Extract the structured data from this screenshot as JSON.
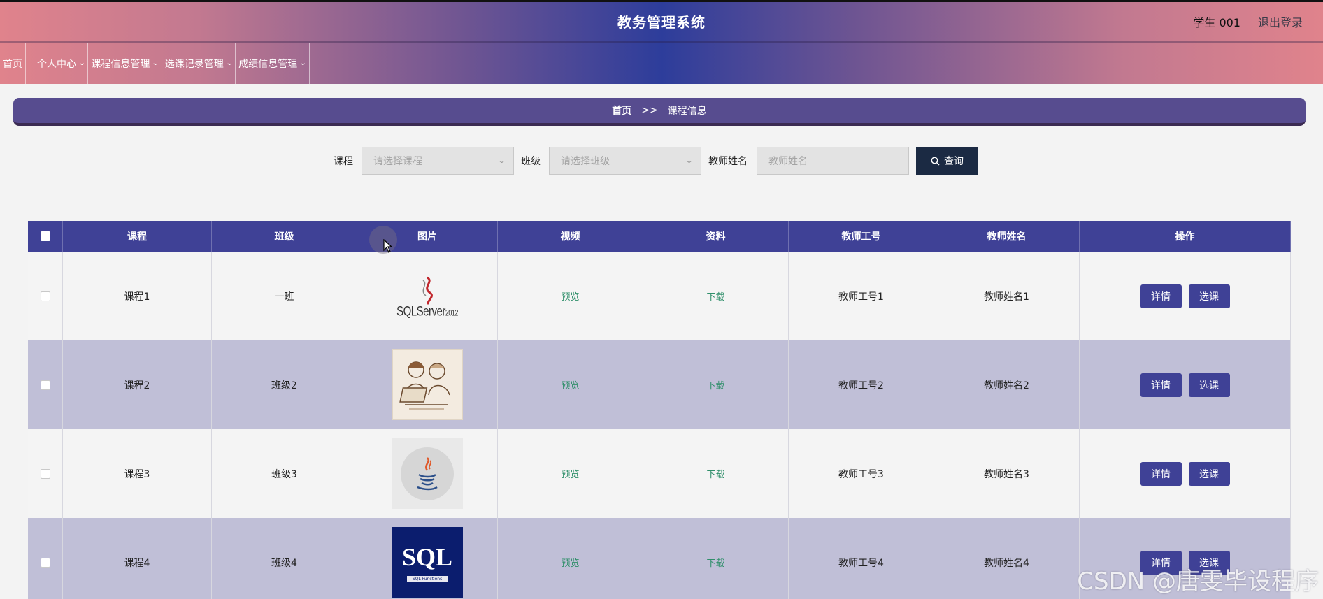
{
  "header": {
    "title": "教务管理系统",
    "user": "学生 001",
    "logout": "退出登录"
  },
  "nav": {
    "items": [
      {
        "label": "首页",
        "has_dropdown": false
      },
      {
        "label": "个人中心",
        "has_dropdown": true
      },
      {
        "label": "课程信息管理",
        "has_dropdown": true
      },
      {
        "label": "选课记录管理",
        "has_dropdown": true
      },
      {
        "label": "成绩信息管理",
        "has_dropdown": true
      }
    ]
  },
  "breadcrumb": {
    "home": "首页",
    "separator": ">>",
    "current": "课程信息"
  },
  "search": {
    "course_label": "课程",
    "course_placeholder": "请选择课程",
    "class_label": "班级",
    "class_placeholder": "请选择班级",
    "teacher_label": "教师姓名",
    "teacher_placeholder": "教师姓名",
    "query_button": "查询"
  },
  "table": {
    "headers": [
      "课程",
      "班级",
      "图片",
      "视频",
      "资料",
      "教师工号",
      "教师姓名",
      "操作"
    ],
    "rows": [
      {
        "course": "课程1",
        "class": "一班",
        "image": "sqlserver-logo",
        "video": "预览",
        "material": "下载",
        "teacher_id": "教师工号1",
        "teacher_name": "教师姓名1",
        "detail": "详情",
        "select": "选课"
      },
      {
        "course": "课程2",
        "class": "班级2",
        "image": "people-computer-sketch",
        "video": "预览",
        "material": "下载",
        "teacher_id": "教师工号2",
        "teacher_name": "教师姓名2",
        "detail": "详情",
        "select": "选课"
      },
      {
        "course": "课程3",
        "class": "班级3",
        "image": "java-logo",
        "video": "预览",
        "material": "下载",
        "teacher_id": "教师工号3",
        "teacher_name": "教师姓名3",
        "detail": "详情",
        "select": "选课"
      },
      {
        "course": "课程4",
        "class": "班级4",
        "image": "sql-functions-cover",
        "video": "预览",
        "material": "下载",
        "teacher_id": "教师工号4",
        "teacher_name": "教师姓名4",
        "detail": "详情",
        "select": "选课"
      }
    ]
  },
  "thumbnails": {
    "sqlserver_text": "SQLServer",
    "sqlserver_version": "2012",
    "sql_title": "SQL",
    "sql_subtitle": "SQL Functions"
  },
  "watermark": "CSDN @唐雯毕设程序",
  "colors": {
    "header_center": "#2d3d9b",
    "header_edge": "#e0838c",
    "primary": "#3f4196",
    "breadcrumb": "#574c8f",
    "query_button": "#1b2a43",
    "link": "#2f8f6a",
    "row_alt": "#c0bfd7"
  }
}
